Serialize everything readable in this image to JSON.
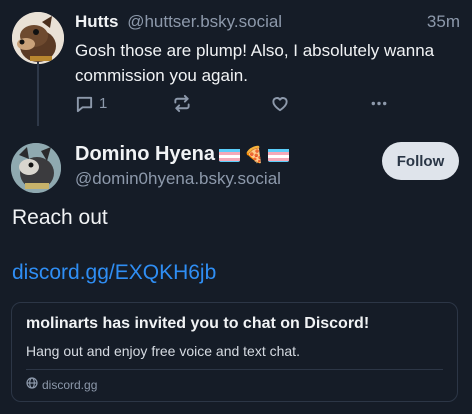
{
  "reply_post": {
    "author_name": "Hutts",
    "author_handle": "@huttser.bsky.social",
    "time": "35m",
    "text": "Gosh those are plump! Also, I absolutely wanna commission you again.",
    "reply_count": "1"
  },
  "main_post": {
    "author_name": "Domino Hyena",
    "author_emoji_pizza": "🍕",
    "author_handle": "@domin0hyena.bsky.social",
    "follow_label": "Follow",
    "text": "Reach out",
    "link": "discord.gg/EXQKH6jb"
  },
  "embed": {
    "title": "molinarts has invited you to chat on Discord!",
    "description": "Hang out and enjoy free voice and text chat.",
    "domain": "discord.gg"
  },
  "colors": {
    "background": "#151c27",
    "link": "#2f8ef4",
    "muted": "#8d99ab",
    "follow_bg": "#dfe4eb"
  },
  "icons": [
    "reply-icon",
    "repost-icon",
    "like-icon",
    "more-icon",
    "globe-icon",
    "trans-flag-icon"
  ]
}
